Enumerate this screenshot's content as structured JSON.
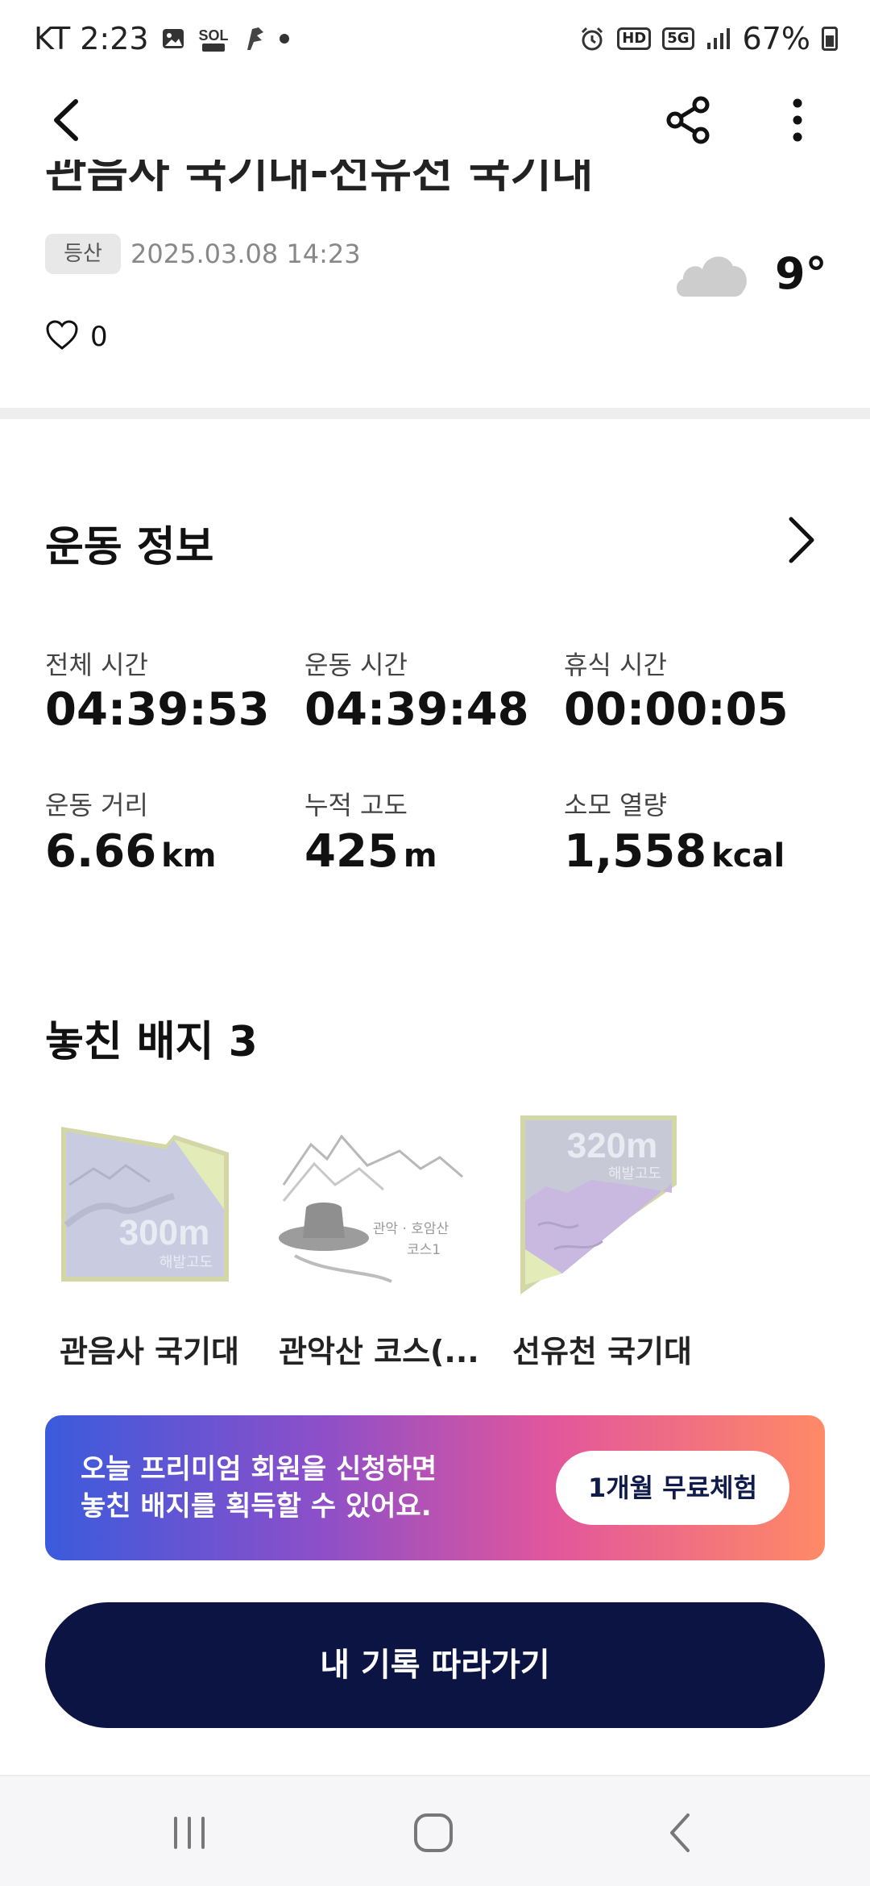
{
  "status_bar": {
    "carrier_time": "KT 2:23",
    "battery": "67%",
    "icons": [
      "gallery-icon",
      "sol-bank-icon",
      "app-icon",
      "notification-dot",
      "alarm-icon",
      "hd-icon",
      "5g-icon",
      "signal-icon",
      "battery-icon"
    ],
    "hd_label": "HD",
    "network_label": "5G"
  },
  "record": {
    "title": "관음사 국기대-선유천 국기대",
    "category_tag": "등산",
    "datetime": "2025.03.08 14:23",
    "temperature": "9°",
    "weather_icon": "cloud-icon",
    "likes": "0"
  },
  "exercise": {
    "title": "운동 정보",
    "stats": [
      {
        "label": "전체 시간",
        "value": "04:39:53",
        "unit": ""
      },
      {
        "label": "운동 시간",
        "value": "04:39:48",
        "unit": ""
      },
      {
        "label": "휴식 시간",
        "value": "00:00:05",
        "unit": ""
      },
      {
        "label": "운동 거리",
        "value": "6.66",
        "unit": "km"
      },
      {
        "label": "누적 고도",
        "value": "425",
        "unit": "m"
      },
      {
        "label": "소모 열량",
        "value": "1,558",
        "unit": "kcal"
      }
    ]
  },
  "badges": {
    "title": "놓친 배지 3",
    "items": [
      {
        "label": "관음사 국기대",
        "big_text": "300m",
        "small_text": "해발고도"
      },
      {
        "label": "관악산 코스(...",
        "caption_line1": "관악 · 호암산",
        "caption_line2": "코스1"
      },
      {
        "label": "선유천 국기대",
        "big_text": "320m",
        "small_text": "해발고도"
      }
    ]
  },
  "promo": {
    "line1": "오늘 프리미엄 회원을 신청하면",
    "line2": "놓친 배지를 획득할 수 있어요.",
    "button": "1개월 무료체험"
  },
  "follow_button": "내 기록 따라가기",
  "colors": {
    "primary_navy": "#0b1442",
    "promo_gradient": [
      "#3a5bdc",
      "#8c4fc9",
      "#e2569c",
      "#ff8a66"
    ],
    "muted_text": "#888888"
  }
}
